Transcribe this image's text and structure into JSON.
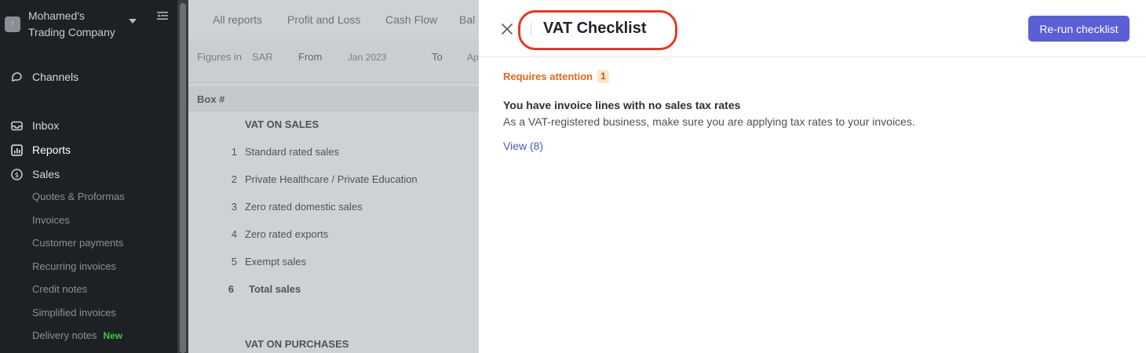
{
  "sidebar": {
    "company_line1": "Mohamed's",
    "company_line2": "Trading Company",
    "items": [
      {
        "label": "Channels"
      },
      {
        "label": "Inbox"
      },
      {
        "label": "Reports"
      },
      {
        "label": "Sales"
      }
    ],
    "sales_sub": [
      {
        "label": "Quotes & Proformas"
      },
      {
        "label": "Invoices"
      },
      {
        "label": "Customer payments"
      },
      {
        "label": "Recurring invoices"
      },
      {
        "label": "Credit notes"
      },
      {
        "label": "Simplified invoices"
      },
      {
        "label": "Delivery notes",
        "badge": "New"
      }
    ]
  },
  "report": {
    "tabs": [
      "All reports",
      "Profit and Loss",
      "Cash Flow",
      "Bal"
    ],
    "filters": {
      "figures_label": "Figures in",
      "currency": "SAR",
      "from_label": "From",
      "from_value": "Jan 2023",
      "to_label": "To",
      "to_value": "Ap"
    },
    "box_header": "Box #",
    "rows": [
      {
        "num": "",
        "label": "VAT ON SALES"
      },
      {
        "num": "1",
        "label": "Standard rated sales"
      },
      {
        "num": "2",
        "label": "Private Healthcare / Private Education"
      },
      {
        "num": "3",
        "label": "Zero rated domestic sales"
      },
      {
        "num": "4",
        "label": "Zero rated exports"
      },
      {
        "num": "5",
        "label": "Exempt sales"
      },
      {
        "num": "6",
        "label": "Total sales"
      },
      {
        "num": "",
        "label": "VAT ON PURCHASES"
      }
    ]
  },
  "drawer": {
    "title": "VAT Checklist",
    "rerun_label": "Re-run checklist",
    "attention_label": "Requires attention",
    "attention_count": "1",
    "issue_title": "You have invoice lines with no sales tax rates",
    "issue_desc": "As a VAT-registered business, make sure you are applying tax rates to your invoices.",
    "view_label": "View (8)"
  },
  "colors": {
    "accent": "#5a5fd6",
    "attention": "#e2671d",
    "highlight_ring": "#e43a22",
    "new_badge": "#3ec443"
  }
}
